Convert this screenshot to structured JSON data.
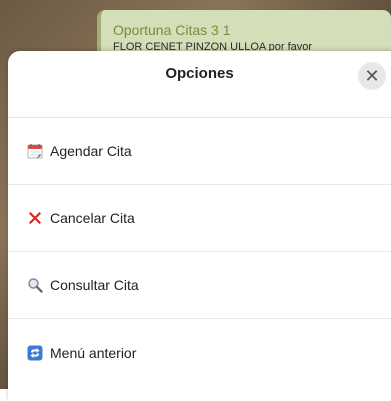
{
  "chat_bubble": {
    "title": "Oportuna Citas 3 1",
    "preview": "FLOR    CENET PINZON  ULLOA  por favor"
  },
  "sheet": {
    "title": "Opciones",
    "close_label": "✕"
  },
  "menu": {
    "items": [
      {
        "label": "Agendar Cita",
        "icon": "calendar-icon"
      },
      {
        "label": "Cancelar Cita",
        "icon": "cross-mark-icon"
      },
      {
        "label": "Consultar Cita",
        "icon": "magnifier-icon"
      },
      {
        "label": "Menú anterior",
        "icon": "back-arrow-icon"
      }
    ]
  },
  "colors": {
    "bubble_bg": "#d4dfb9",
    "bubble_title": "#7a8d39",
    "cancel_red": "#e02020",
    "back_blue": "#3a7bd5"
  }
}
